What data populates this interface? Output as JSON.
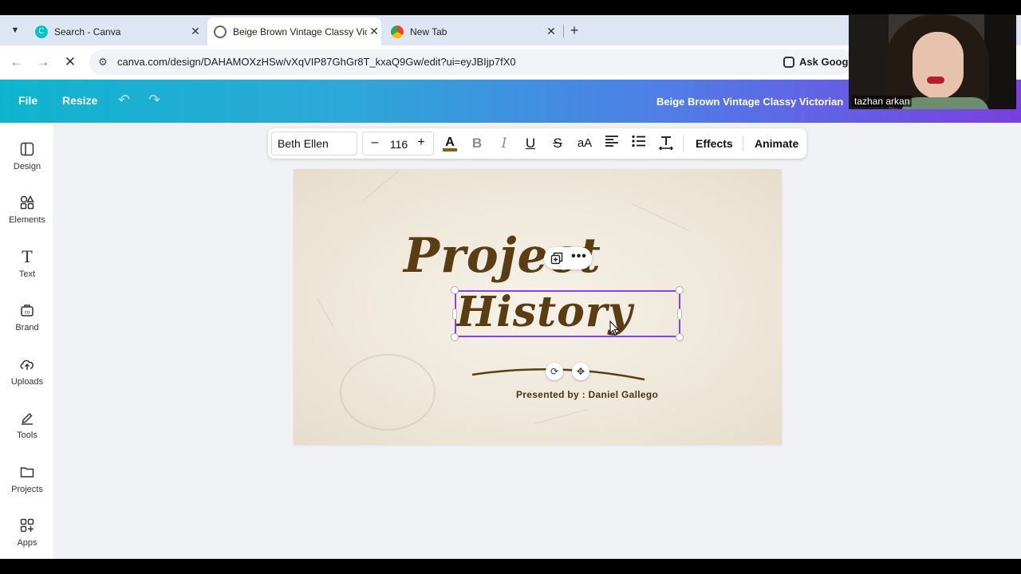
{
  "browser": {
    "tabs": [
      {
        "title": "Search - Canva",
        "active": false
      },
      {
        "title": "Beige Brown Vintage Classy Vic",
        "active": true
      },
      {
        "title": "New Tab",
        "active": false
      }
    ],
    "url": "canva.com/design/DAHAMOXzHSw/vXqVIP87GhGr8T_kxaQ9Gw/edit?ui=eyJBIjp7fX0",
    "ask_google": "Ask Google"
  },
  "header": {
    "file": "File",
    "resize": "Resize",
    "doc_title": "Beige Brown Vintage Classy Victorian"
  },
  "webcam": {
    "name": "tazhan arkan"
  },
  "sidebar": {
    "items": [
      {
        "label": "Design",
        "icon": "design-icon"
      },
      {
        "label": "Elements",
        "icon": "elements-icon"
      },
      {
        "label": "Text",
        "icon": "text-icon"
      },
      {
        "label": "Brand",
        "icon": "brand-icon"
      },
      {
        "label": "Uploads",
        "icon": "uploads-icon"
      },
      {
        "label": "Tools",
        "icon": "tools-icon"
      },
      {
        "label": "Projects",
        "icon": "projects-icon"
      },
      {
        "label": "Apps",
        "icon": "apps-icon"
      }
    ]
  },
  "toolbar": {
    "font": "Beth Ellen",
    "font_size": "116",
    "effects": "Effects",
    "animate": "Animate",
    "text_color": "#8a5a1c"
  },
  "slide": {
    "title_line1": "Project",
    "title_line2": "History",
    "presented_by": "Presented by : Daniel Gallego",
    "text_color": "#5a3d12"
  },
  "colors": {
    "accent": "#8b3dff"
  }
}
